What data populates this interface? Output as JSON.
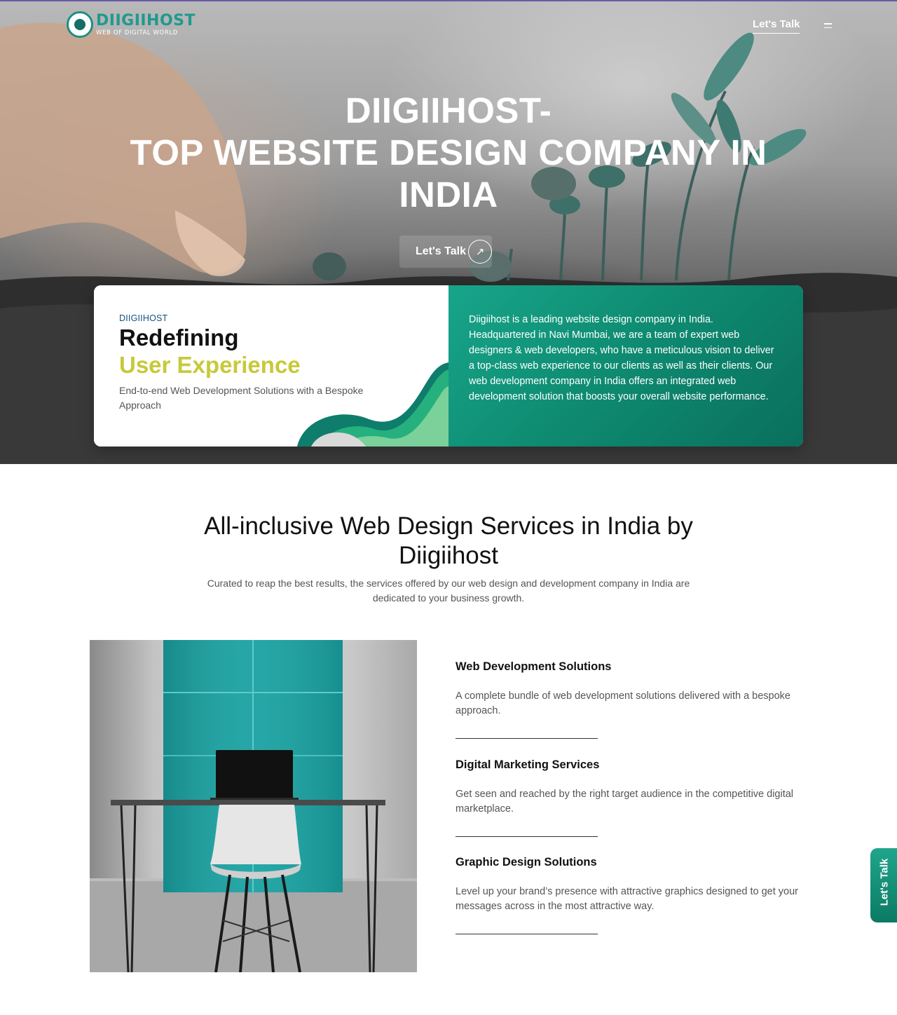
{
  "header": {
    "logo_name": "DIIGIIHOST",
    "logo_tagline": "WEB OF DIGITAL WORLD",
    "nav_cta": "Let's Talk"
  },
  "hero": {
    "title_line1": "DIIGIIHOST-",
    "title_line2": "TOP WEBSITE DESIGN COMPANY IN",
    "title_line3": "INDIA",
    "cta_label": "Let's Talk",
    "cta_arrow": "↗"
  },
  "info_card": {
    "kicker": "DIIGIIHOST",
    "heading_line1": "Redefining",
    "heading_line2": "User Experience",
    "subheading": "End-to-end Web Development Solutions with a Bespoke Approach",
    "description": "Diigiihost is a leading website design company in India. Headquartered in Navi Mumbai, we are a team of expert web designers & web developers, who have a meticulous vision to deliver a top-class web experience to our clients as well as their clients. Our web development company in India offers an integrated web development solution that boosts your overall website performance."
  },
  "services": {
    "title": "All-inclusive Web Design Services in India by Diigiihost",
    "subtitle": "Curated to reap the best results, the services offered by our web design and development company in India are dedicated to your business growth.",
    "items": [
      {
        "title": "Web Development Solutions",
        "desc": "A complete bundle of web development solutions delivered with a bespoke approach."
      },
      {
        "title": "Digital Marketing Services",
        "desc": "Get seen and reached by the right target audience in the competitive digital marketplace."
      },
      {
        "title": "Graphic Design Solutions",
        "desc": "Level up your brand’s presence with attractive graphics designed to get your messages across in the most attractive way."
      }
    ]
  },
  "side_tab": {
    "label": "Let's Talk"
  },
  "colors": {
    "brand_teal": "#1f9a8e",
    "accent_lime": "#c7c93a",
    "card_green": "#0e8a70"
  },
  "icons": {
    "menu": "hamburger-menu-icon",
    "cta_arrow": "arrow-up-right-icon",
    "logo": "spider-logo-icon"
  }
}
